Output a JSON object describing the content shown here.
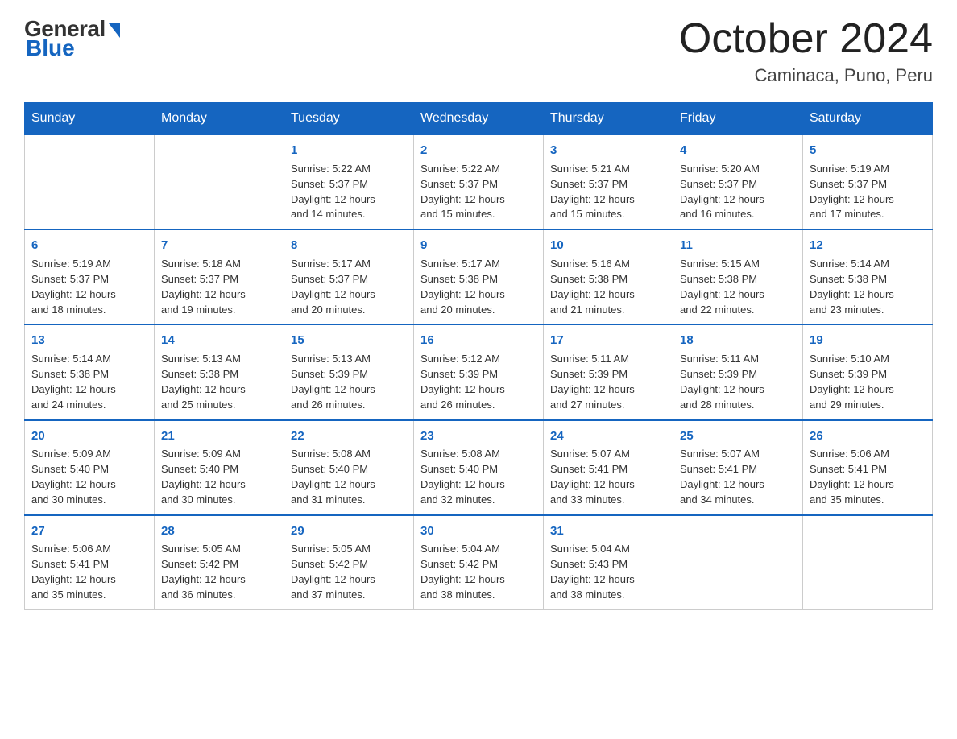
{
  "logo": {
    "general": "General",
    "blue": "Blue"
  },
  "title": {
    "month_year": "October 2024",
    "location": "Caminaca, Puno, Peru"
  },
  "header_days": [
    "Sunday",
    "Monday",
    "Tuesday",
    "Wednesday",
    "Thursday",
    "Friday",
    "Saturday"
  ],
  "weeks": [
    [
      {
        "day": "",
        "info": ""
      },
      {
        "day": "",
        "info": ""
      },
      {
        "day": "1",
        "info": "Sunrise: 5:22 AM\nSunset: 5:37 PM\nDaylight: 12 hours\nand 14 minutes."
      },
      {
        "day": "2",
        "info": "Sunrise: 5:22 AM\nSunset: 5:37 PM\nDaylight: 12 hours\nand 15 minutes."
      },
      {
        "day": "3",
        "info": "Sunrise: 5:21 AM\nSunset: 5:37 PM\nDaylight: 12 hours\nand 15 minutes."
      },
      {
        "day": "4",
        "info": "Sunrise: 5:20 AM\nSunset: 5:37 PM\nDaylight: 12 hours\nand 16 minutes."
      },
      {
        "day": "5",
        "info": "Sunrise: 5:19 AM\nSunset: 5:37 PM\nDaylight: 12 hours\nand 17 minutes."
      }
    ],
    [
      {
        "day": "6",
        "info": "Sunrise: 5:19 AM\nSunset: 5:37 PM\nDaylight: 12 hours\nand 18 minutes."
      },
      {
        "day": "7",
        "info": "Sunrise: 5:18 AM\nSunset: 5:37 PM\nDaylight: 12 hours\nand 19 minutes."
      },
      {
        "day": "8",
        "info": "Sunrise: 5:17 AM\nSunset: 5:37 PM\nDaylight: 12 hours\nand 20 minutes."
      },
      {
        "day": "9",
        "info": "Sunrise: 5:17 AM\nSunset: 5:38 PM\nDaylight: 12 hours\nand 20 minutes."
      },
      {
        "day": "10",
        "info": "Sunrise: 5:16 AM\nSunset: 5:38 PM\nDaylight: 12 hours\nand 21 minutes."
      },
      {
        "day": "11",
        "info": "Sunrise: 5:15 AM\nSunset: 5:38 PM\nDaylight: 12 hours\nand 22 minutes."
      },
      {
        "day": "12",
        "info": "Sunrise: 5:14 AM\nSunset: 5:38 PM\nDaylight: 12 hours\nand 23 minutes."
      }
    ],
    [
      {
        "day": "13",
        "info": "Sunrise: 5:14 AM\nSunset: 5:38 PM\nDaylight: 12 hours\nand 24 minutes."
      },
      {
        "day": "14",
        "info": "Sunrise: 5:13 AM\nSunset: 5:38 PM\nDaylight: 12 hours\nand 25 minutes."
      },
      {
        "day": "15",
        "info": "Sunrise: 5:13 AM\nSunset: 5:39 PM\nDaylight: 12 hours\nand 26 minutes."
      },
      {
        "day": "16",
        "info": "Sunrise: 5:12 AM\nSunset: 5:39 PM\nDaylight: 12 hours\nand 26 minutes."
      },
      {
        "day": "17",
        "info": "Sunrise: 5:11 AM\nSunset: 5:39 PM\nDaylight: 12 hours\nand 27 minutes."
      },
      {
        "day": "18",
        "info": "Sunrise: 5:11 AM\nSunset: 5:39 PM\nDaylight: 12 hours\nand 28 minutes."
      },
      {
        "day": "19",
        "info": "Sunrise: 5:10 AM\nSunset: 5:39 PM\nDaylight: 12 hours\nand 29 minutes."
      }
    ],
    [
      {
        "day": "20",
        "info": "Sunrise: 5:09 AM\nSunset: 5:40 PM\nDaylight: 12 hours\nand 30 minutes."
      },
      {
        "day": "21",
        "info": "Sunrise: 5:09 AM\nSunset: 5:40 PM\nDaylight: 12 hours\nand 30 minutes."
      },
      {
        "day": "22",
        "info": "Sunrise: 5:08 AM\nSunset: 5:40 PM\nDaylight: 12 hours\nand 31 minutes."
      },
      {
        "day": "23",
        "info": "Sunrise: 5:08 AM\nSunset: 5:40 PM\nDaylight: 12 hours\nand 32 minutes."
      },
      {
        "day": "24",
        "info": "Sunrise: 5:07 AM\nSunset: 5:41 PM\nDaylight: 12 hours\nand 33 minutes."
      },
      {
        "day": "25",
        "info": "Sunrise: 5:07 AM\nSunset: 5:41 PM\nDaylight: 12 hours\nand 34 minutes."
      },
      {
        "day": "26",
        "info": "Sunrise: 5:06 AM\nSunset: 5:41 PM\nDaylight: 12 hours\nand 35 minutes."
      }
    ],
    [
      {
        "day": "27",
        "info": "Sunrise: 5:06 AM\nSunset: 5:41 PM\nDaylight: 12 hours\nand 35 minutes."
      },
      {
        "day": "28",
        "info": "Sunrise: 5:05 AM\nSunset: 5:42 PM\nDaylight: 12 hours\nand 36 minutes."
      },
      {
        "day": "29",
        "info": "Sunrise: 5:05 AM\nSunset: 5:42 PM\nDaylight: 12 hours\nand 37 minutes."
      },
      {
        "day": "30",
        "info": "Sunrise: 5:04 AM\nSunset: 5:42 PM\nDaylight: 12 hours\nand 38 minutes."
      },
      {
        "day": "31",
        "info": "Sunrise: 5:04 AM\nSunset: 5:43 PM\nDaylight: 12 hours\nand 38 minutes."
      },
      {
        "day": "",
        "info": ""
      },
      {
        "day": "",
        "info": ""
      }
    ]
  ]
}
